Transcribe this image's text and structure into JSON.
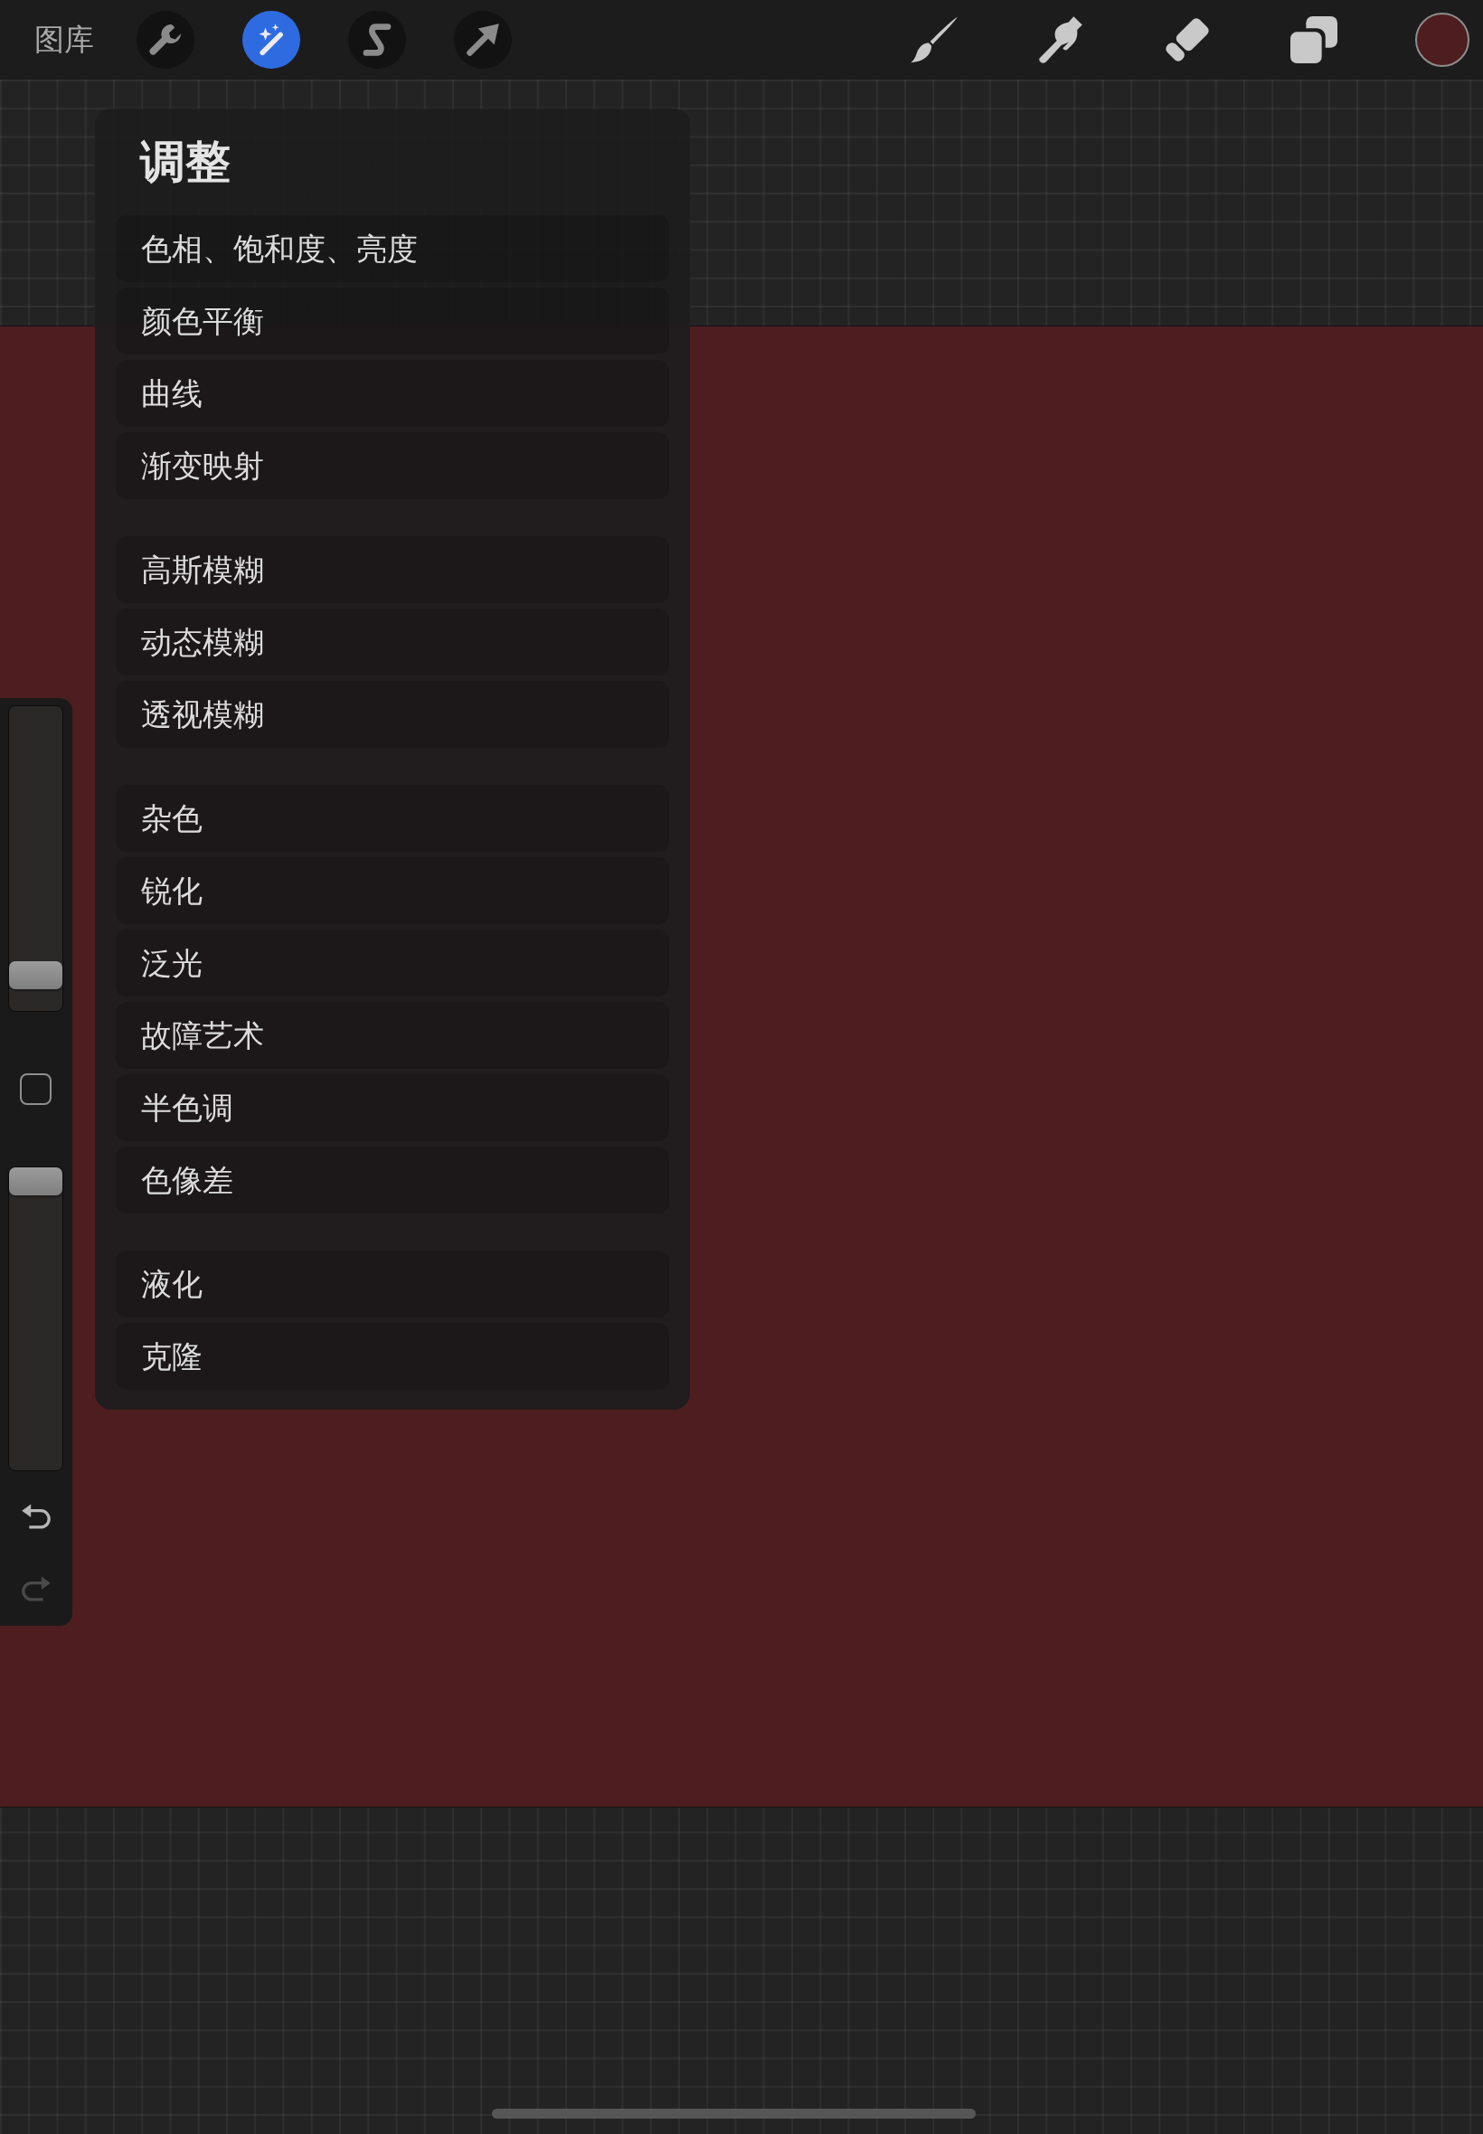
{
  "toolbar": {
    "gallery": "图库",
    "tools": [
      {
        "kind": "wrench",
        "selected": false
      },
      {
        "kind": "wand",
        "selected": true
      },
      {
        "kind": "selection",
        "selected": false
      },
      {
        "kind": "transform",
        "selected": false
      }
    ],
    "right_tools": [
      {
        "kind": "brush",
        "selected": false
      },
      {
        "kind": "smudge",
        "selected": false
      },
      {
        "kind": "eraser",
        "selected": false
      },
      {
        "kind": "layers",
        "selected": false
      }
    ],
    "current_color": {
      "color": "#4e1d1f"
    }
  },
  "adjustments": {
    "title": "调整",
    "groups": [
      {
        "items": [
          "色相、饱和度、亮度",
          "颜色平衡",
          "曲线",
          "渐变映射"
        ]
      },
      {
        "items": [
          "高斯模糊",
          "动态模糊",
          "透视模糊"
        ]
      },
      {
        "items": [
          "杂色",
          "锐化",
          "泛光",
          "故障艺术",
          "半色调",
          "色像差"
        ]
      },
      {
        "items": [
          "液化",
          "克隆"
        ]
      }
    ]
  },
  "sidebar": {
    "sliders": [
      {
        "level": 0.08
      },
      {
        "level": 1
      }
    ],
    "history": [
      {
        "kind": "undo",
        "disabled": false
      },
      {
        "kind": "redo",
        "disabled": true
      }
    ]
  }
}
